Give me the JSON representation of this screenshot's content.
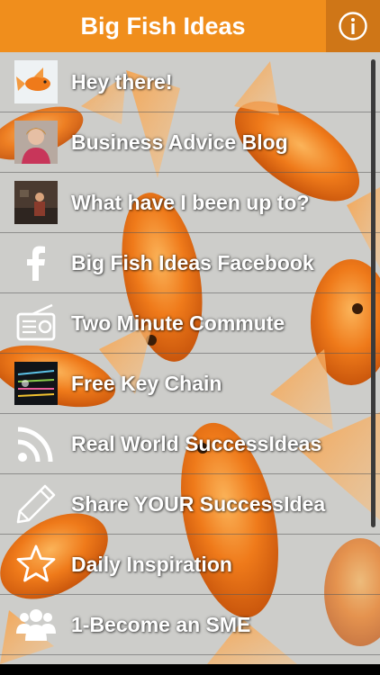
{
  "header": {
    "title": "Big Fish Ideas",
    "info_icon": "info-icon"
  },
  "menu": [
    {
      "label": "Hey there!",
      "icon": "goldfish-thumbnail"
    },
    {
      "label": "Business Advice Blog",
      "icon": "woman-portrait-thumbnail"
    },
    {
      "label": "What have I been up to?",
      "icon": "speaker-photo-thumbnail"
    },
    {
      "label": "Big Fish Ideas Facebook",
      "icon": "facebook-icon"
    },
    {
      "label": "Two Minute Commute",
      "icon": "radio-icon"
    },
    {
      "label": "Free Key Chain",
      "icon": "key-chain-thumbnail"
    },
    {
      "label": "Real World SuccessIdeas",
      "icon": "rss-icon"
    },
    {
      "label": "Share YOUR SuccessIdea",
      "icon": "pencil-icon"
    },
    {
      "label": "Daily Inspiration",
      "icon": "star-icon"
    },
    {
      "label": "1-Become an SME",
      "icon": "users-icon"
    }
  ],
  "colors": {
    "header": "#f08e1c",
    "info_button": "#cf7617",
    "fish": "#ef7a1a",
    "background": "#c9c9c6"
  }
}
